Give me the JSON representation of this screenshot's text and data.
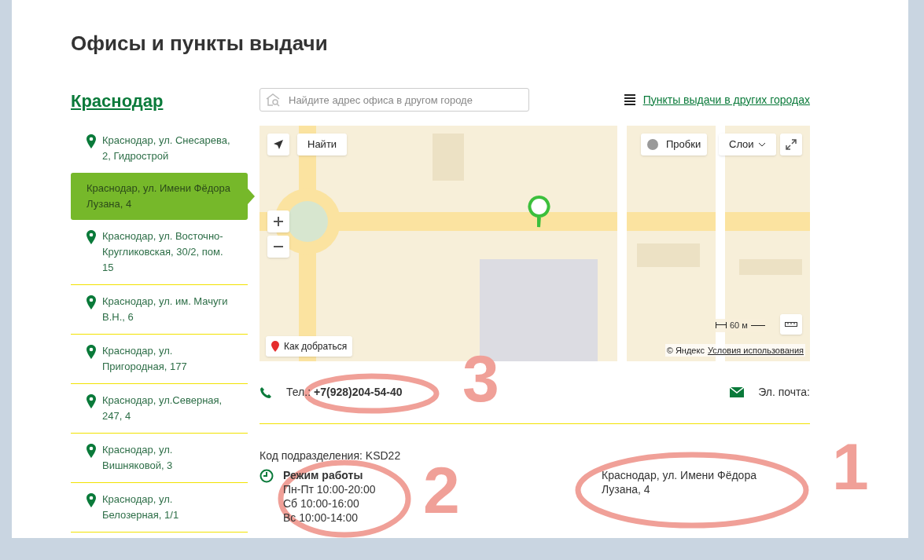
{
  "page_title": "Офисы и пункты выдачи",
  "city": "Краснодар",
  "offices": [
    {
      "address": "Краснодар, ул. Снесарева, 2, Гидрострой",
      "selected": false
    },
    {
      "address": "Краснодар, ул. Имени Фёдора Лузана, 4",
      "selected": true
    },
    {
      "address": "Краснодар, ул. Восточно-Кругликовская, 30/2, пом. 15",
      "selected": false
    },
    {
      "address": "Краснодар, ул. им. Мачуги В.Н., 6",
      "selected": false
    },
    {
      "address": "Краснодар, ул. Пригородная, 177",
      "selected": false
    },
    {
      "address": "Краснодар, ул.Северная, 247, 4",
      "selected": false
    },
    {
      "address": "Краснодар, ул. Вишняковой, 3",
      "selected": false
    },
    {
      "address": "Краснодар, ул. Белозерная, 1/1",
      "selected": false
    }
  ],
  "search": {
    "placeholder": "Найдите адрес офиса в другом городе"
  },
  "other_cities_link": "Пункты выдачи в других городах",
  "map": {
    "find_button": "Найти",
    "traffic_button": "Пробки",
    "layers_button": "Слои",
    "route_button": "Как добраться",
    "scale": "60 м",
    "copyright": "© Яндекс",
    "terms_link": "Условия использования"
  },
  "contacts": {
    "phone_label": "Тел.:",
    "phone": "+7(928)204-54-40",
    "email_label": "Эл. почта:"
  },
  "details": {
    "code": "Код подразделения: KSD22",
    "hours_title": "Режим работы",
    "hours": [
      "Пн-Пт 10:00-20:00",
      "Сб 10:00-16:00",
      "Вс 10:00-14:00"
    ],
    "address": "Краснодар, ул. Имени Фёдора Лузана, 4"
  },
  "annotations": [
    {
      "label": "3"
    },
    {
      "label": "2"
    },
    {
      "label": "1"
    }
  ]
}
